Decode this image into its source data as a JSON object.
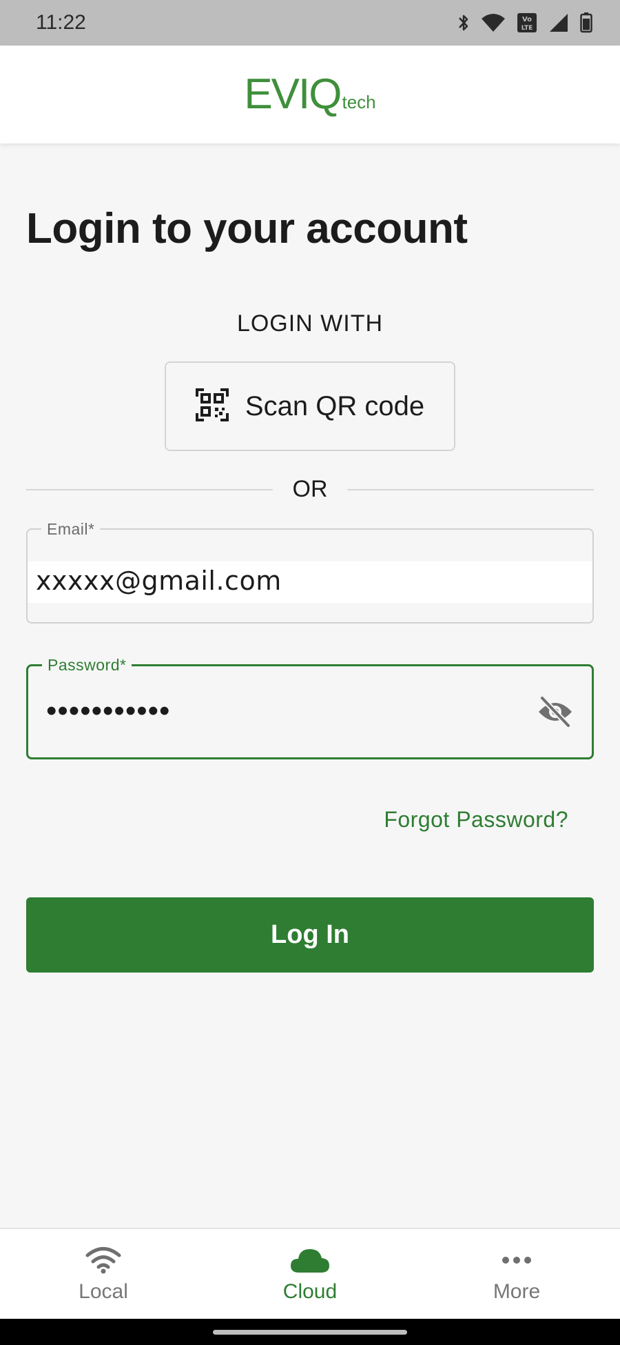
{
  "status_bar": {
    "time": "11:22",
    "icons": [
      "bluetooth-icon",
      "wifi-icon",
      "volte-icon",
      "signal-icon",
      "battery-icon"
    ],
    "volte_text": "Vo LTE"
  },
  "header": {
    "logo_main": "EVIQ",
    "logo_sub": "tech"
  },
  "login": {
    "title": "Login to your account",
    "login_with": "LOGIN WITH",
    "qr_button_label": "Scan QR code",
    "divider_text": "OR",
    "email": {
      "label": "Email*",
      "value": "xxxxx@gmail.com"
    },
    "password": {
      "label": "Password*",
      "value": "•••••••••••"
    },
    "forgot_password": "Forgot Password?",
    "login_button": "Log In"
  },
  "bottom_nav": {
    "items": [
      {
        "label": "Local",
        "icon": "wifi-icon",
        "active": false
      },
      {
        "label": "Cloud",
        "icon": "cloud-icon",
        "active": true
      },
      {
        "label": "More",
        "icon": "more-horizontal-icon",
        "active": false
      }
    ]
  },
  "colors": {
    "accent": "#2e7d32",
    "logo": "#3f8f3b",
    "background": "#f6f6f6",
    "status_bar": "#bdbdbd"
  }
}
